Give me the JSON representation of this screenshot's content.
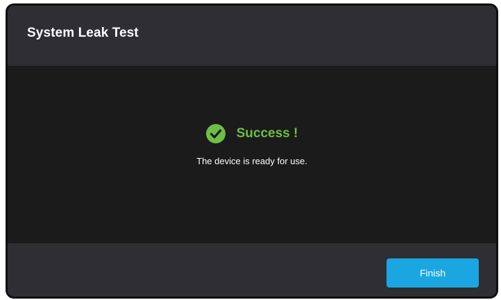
{
  "dialog": {
    "title": "System Leak Test",
    "status": {
      "icon": "check-circle-icon",
      "text": "Success !",
      "color": "#6dbe45"
    },
    "message": "The device is ready for use.",
    "finish_label": "Finish",
    "accent_color": "#1aa6e0"
  }
}
